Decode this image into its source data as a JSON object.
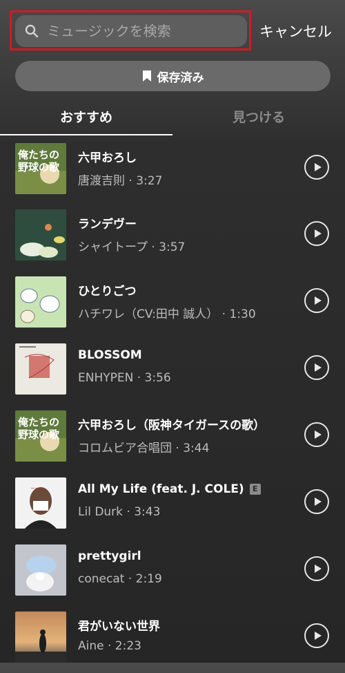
{
  "search": {
    "placeholder": "ミュージックを検索",
    "cancel_label": "キャンセル"
  },
  "saved_button": {
    "label": "保存済み",
    "icon": "bookmark-icon"
  },
  "tabs": [
    {
      "label": "おすすめ",
      "active": true
    },
    {
      "label": "見つける",
      "active": false
    }
  ],
  "tracks": [
    {
      "title": "六甲おろし",
      "subtitle": "唐渡吉則 · 3:27",
      "art": "baseball-art",
      "explicit": false
    },
    {
      "title": "ランデヴー",
      "subtitle": "シャイトープ · 3:57",
      "art": "flower-art",
      "explicit": false
    },
    {
      "title": "ひとりごつ",
      "subtitle": "ハチワレ（CV:田中 誠人） · 1:30",
      "art": "character-art",
      "explicit": false
    },
    {
      "title": "BLOSSOM",
      "subtitle": "ENHYPEN · 3:56",
      "art": "red-sketch-art",
      "explicit": false
    },
    {
      "title": "六甲おろし（阪神タイガースの歌）",
      "subtitle": "コロムビア合唱団 · 3:44",
      "art": "baseball-art",
      "explicit": false
    },
    {
      "title": "All My Life (feat. J. COLE)",
      "subtitle": "Lil Durk · 3:43",
      "art": "portrait-art",
      "explicit": true,
      "explicit_label": "E"
    },
    {
      "title": "prettygirl",
      "subtitle": "conecat · 2:19",
      "art": "plush-art",
      "explicit": false
    },
    {
      "title": "君がいない世界",
      "subtitle": "Aine · 2:23",
      "art": "sunset-art",
      "explicit": false
    }
  ]
}
